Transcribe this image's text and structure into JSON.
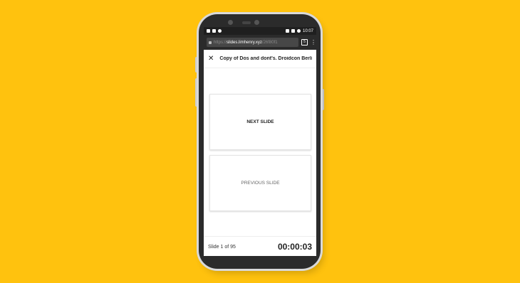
{
  "statusbar": {
    "time": "10:07",
    "left_icons": [
      "notification-icon",
      "image-icon",
      "app-icon"
    ],
    "right_icons": [
      "vibrate-icon",
      "signal-icon",
      "battery-icon"
    ]
  },
  "browser": {
    "url_scheme": "https://",
    "url_host": "slides.limhenry.xyz",
    "url_path": "/26f80f1",
    "tabs_count": "5",
    "menu_glyph": "⋮"
  },
  "appbar": {
    "close_glyph": "✕",
    "title": "Copy of Dos and dont's. Droidcon Berlin."
  },
  "controls": {
    "next_label": "NEXT SLIDE",
    "prev_label": "PREVIOUS SLIDE"
  },
  "footer": {
    "slide_counter": "Slide 1 of 95",
    "timer": "00:00:03"
  },
  "colors": {
    "background": "#FFC20E",
    "phone_body": "#2b2b2b"
  }
}
